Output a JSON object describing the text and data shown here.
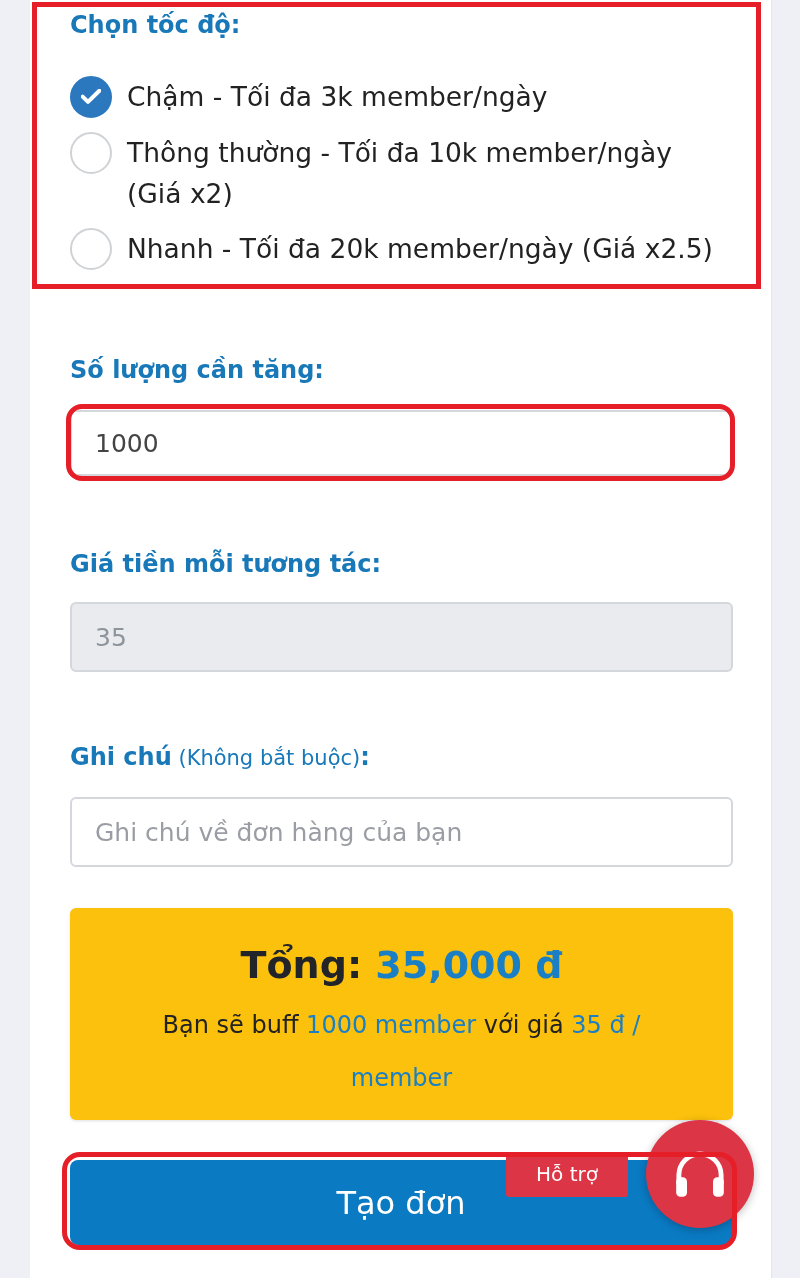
{
  "speed": {
    "label": "Chọn tốc độ:",
    "highlighted": true,
    "options": [
      {
        "label": "Chậm - Tối đa 3k member/ngày",
        "selected": true
      },
      {
        "label": "Thông thường - Tối đa 10k member/ngày (Giá x2)",
        "selected": false
      },
      {
        "label": "Nhanh - Tối đa 20k member/ngày (Giá x2.5)",
        "selected": false
      }
    ]
  },
  "quantity": {
    "label": "Số lượng cần tăng:",
    "value": "1000",
    "highlighted": true
  },
  "unit_price": {
    "label": "Giá tiền mỗi tương tác:",
    "value": "35",
    "disabled": true
  },
  "note": {
    "label": "**Ghi chú** (Không bắt buộc)**:**",
    "placeholder": "Ghi chú về đơn hàng của bạn"
  },
  "summary": {
    "total_label": "Tổng:",
    "total_value": "35,000 đ",
    "description": [
      {
        "text": "Bạn sẽ buff",
        "accent": false
      },
      {
        "text": "1000 member",
        "accent": true
      },
      {
        "text": "với giá",
        "accent": false
      },
      {
        "text": "35 đ / member",
        "accent": true
      }
    ]
  },
  "submit_button": {
    "label": "Tạo đơn",
    "highlighted": true
  },
  "support": {
    "label": "Hỗ trợ"
  }
}
